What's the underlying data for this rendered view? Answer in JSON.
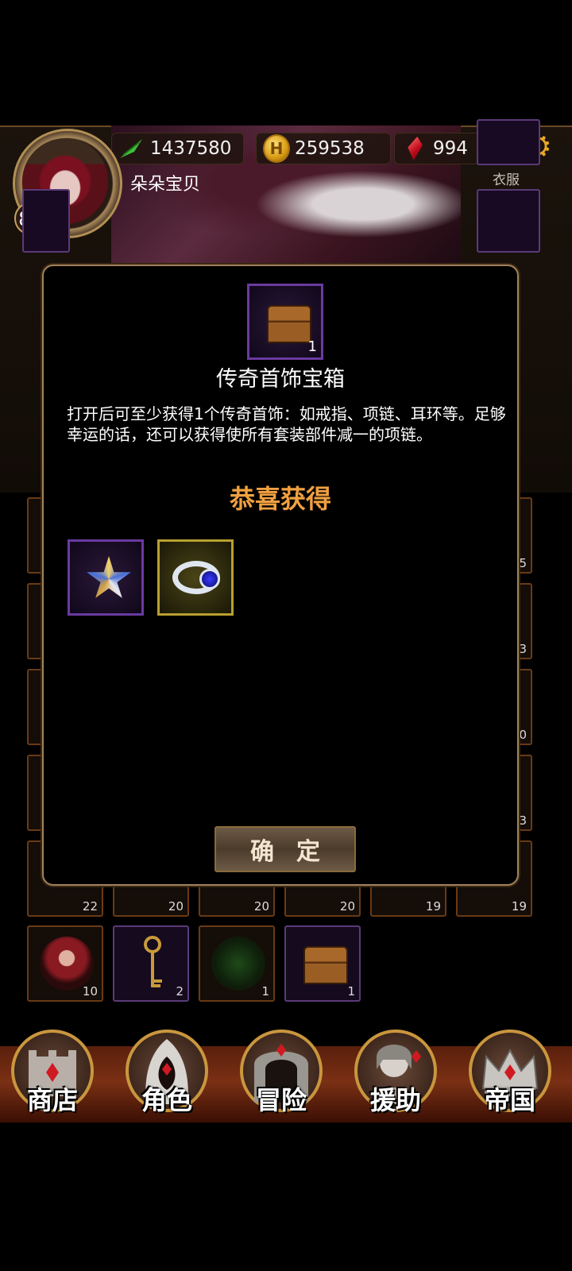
{
  "player": {
    "name": "朵朵宝贝",
    "level": "81",
    "power": "1437580",
    "gold": "259538",
    "gems": "994"
  },
  "equipment_labels": {
    "clothes": "衣服"
  },
  "icons": {
    "power": "green-feather-icon",
    "gold": "gold-coin-icon",
    "gems": "red-gem-icon",
    "settings": "gear-icon"
  },
  "inventory": {
    "partial_row_counts": [
      "22",
      "20",
      "20",
      "20",
      "19",
      "19"
    ],
    "right_edge_counts": [
      "5",
      "3",
      "0",
      "3"
    ],
    "items": [
      {
        "count": "10",
        "icon": "character-portrait-icon"
      },
      {
        "count": "2",
        "icon": "gold-key-icon"
      },
      {
        "count": "1",
        "icon": "vine-creature-icon"
      },
      {
        "count": "1",
        "icon": "treasure-chest-icon"
      }
    ]
  },
  "modal": {
    "item_count": "1",
    "item_icon": "treasure-chest-icon",
    "title": "传奇首饰宝箱",
    "description": "打开后可至少获得1个传奇首饰：如戒指、项链、耳环等。足够幸运的话，还可以获得使所有套装部件减一的项链。",
    "congrats": "恭喜获得",
    "rewards": [
      {
        "icon": "star-amulet-icon",
        "rarity": "epic"
      },
      {
        "icon": "sapphire-ring-icon",
        "rarity": "legendary"
      }
    ],
    "confirm": "确定"
  },
  "nav": [
    {
      "label": "商店",
      "icon": "castle-icon"
    },
    {
      "label": "角色",
      "icon": "hooded-figure-icon"
    },
    {
      "label": "冒险",
      "icon": "dungeon-gate-icon"
    },
    {
      "label": "援助",
      "icon": "helper-girl-icon"
    },
    {
      "label": "帝国",
      "icon": "crown-icon"
    }
  ],
  "colors": {
    "congrats_text": "#f0a040",
    "epic_border": "#6a3aa0",
    "legendary_border": "#b8a030",
    "modal_border": "#a2825a"
  }
}
